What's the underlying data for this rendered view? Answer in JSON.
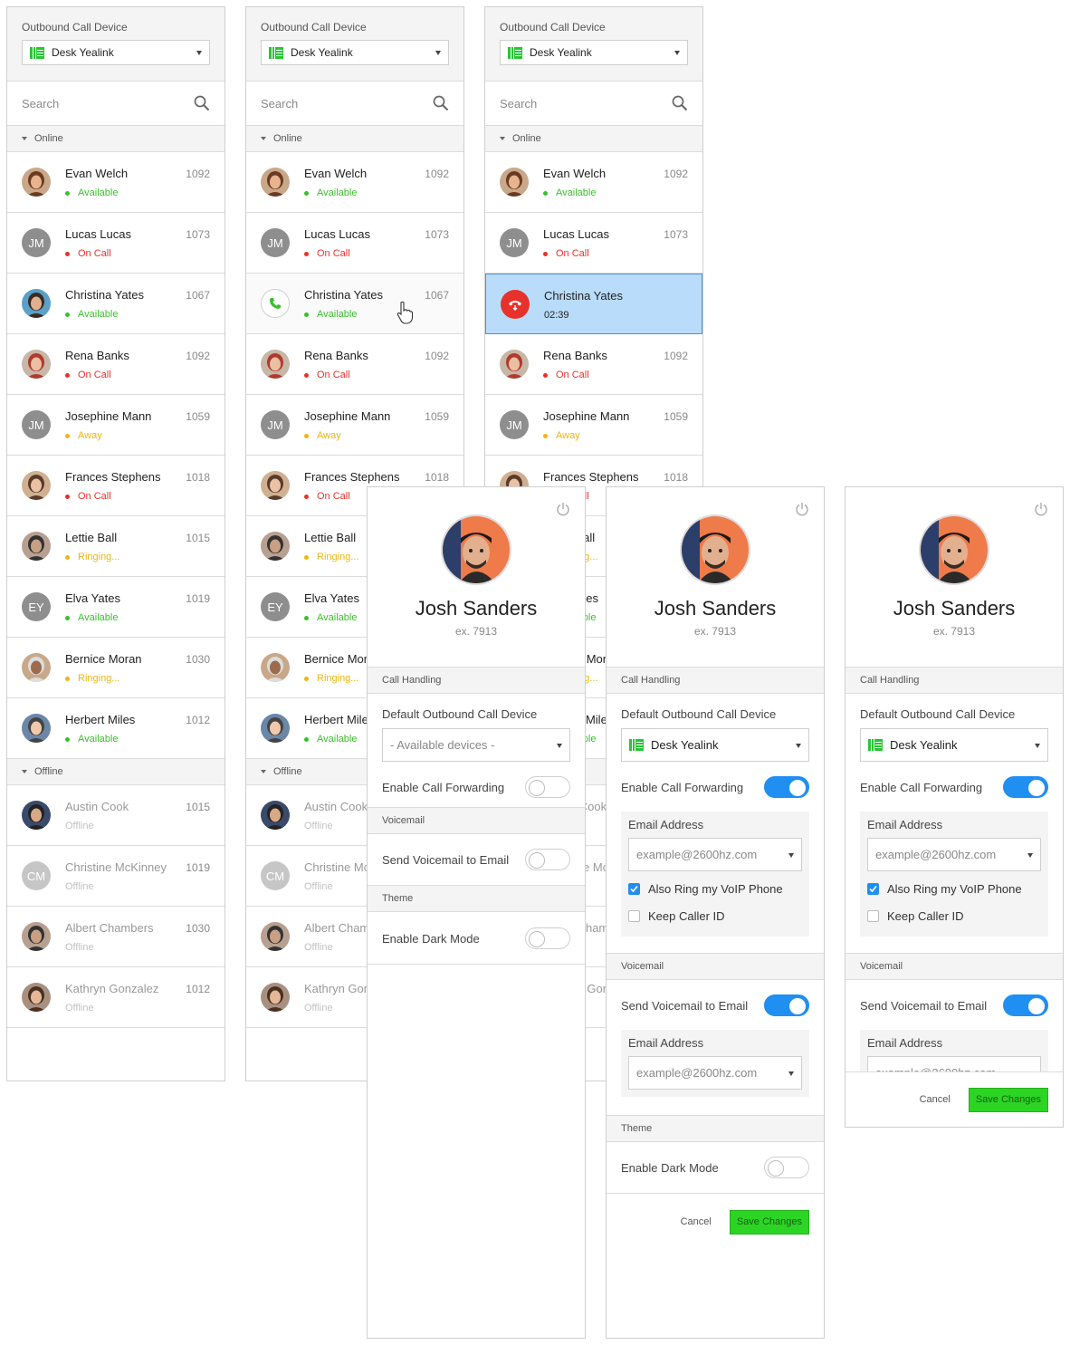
{
  "sidebar": {
    "device_label": "Outbound Call Device",
    "device_value": "Desk Yealink",
    "search_placeholder": "Search",
    "group_online": "Online",
    "group_offline": "Offline"
  },
  "contacts": {
    "online": [
      {
        "name": "Evan Welch",
        "ext": "1092",
        "status": "Available",
        "status_type": "available"
      },
      {
        "name": "Lucas Lucas",
        "ext": "1073",
        "status": "On Call",
        "status_type": "oncall",
        "initials": "JM"
      },
      {
        "name": "Christina Yates",
        "ext": "1067",
        "status": "Available",
        "status_type": "available"
      },
      {
        "name": "Rena Banks",
        "ext": "1092",
        "status": "On Call",
        "status_type": "oncall"
      },
      {
        "name": "Josephine Mann",
        "ext": "1059",
        "status": "Away",
        "status_type": "away",
        "initials": "JM"
      },
      {
        "name": "Frances Stephens",
        "ext": "1018",
        "status": "On Call",
        "status_type": "oncall"
      },
      {
        "name": "Lettie Ball",
        "ext": "1015",
        "status": "Ringing...",
        "status_type": "ringing"
      },
      {
        "name": "Elva Yates",
        "ext": "1019",
        "status": "Available",
        "status_type": "available",
        "initials": "EY"
      },
      {
        "name": "Bernice Moran",
        "ext": "1030",
        "status": "Ringing...",
        "status_type": "ringing"
      },
      {
        "name": "Herbert Miles",
        "ext": "1012",
        "status": "Available",
        "status_type": "available"
      }
    ],
    "offline": [
      {
        "name": "Austin Cook",
        "ext": "1015",
        "status": "Offline"
      },
      {
        "name": "Christine McKinney",
        "ext": "1019",
        "status": "Offline",
        "initials": "CM"
      },
      {
        "name": "Albert Chambers",
        "ext": "1030",
        "status": "Offline"
      },
      {
        "name": "Kathryn Gonzalez",
        "ext": "1012",
        "status": "Offline"
      }
    ],
    "active_call_timer": "02:39"
  },
  "profile": {
    "name": "Josh Sanders",
    "ext": "ex. 7913"
  },
  "settings": {
    "call_handling_header": "Call Handling",
    "default_device_label": "Default Outbound Call Device",
    "available_devices_placeholder": "- Available devices -",
    "device_value": "Desk Yealink",
    "enable_forwarding_label": "Enable Call Forwarding",
    "email_address_label": "Email Address",
    "email_placeholder": "example@2600hz.com",
    "also_ring_label": "Also Ring my VoIP Phone",
    "keep_caller_id_label": "Keep Caller ID",
    "voicemail_header": "Voicemail",
    "send_voicemail_label": "Send Voicemail to Email",
    "theme_header": "Theme",
    "dark_mode_label": "Enable Dark Mode",
    "cancel_label": "Cancel",
    "save_label": "Save Changes"
  },
  "colors": {
    "available": "#3bbf2e",
    "on_call": "#e6322b",
    "away": "#efb511",
    "accent_blue": "#1f8ff2",
    "save_green": "#2cd524",
    "active_row": "#b9dcfa"
  }
}
